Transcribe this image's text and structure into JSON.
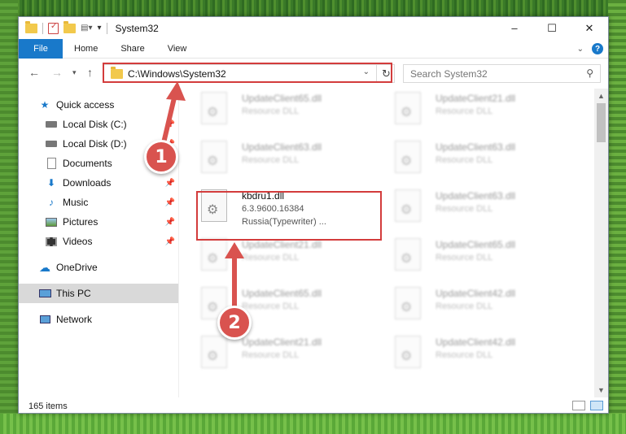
{
  "window": {
    "title": "System32",
    "controls": [
      "–",
      "☐",
      "✕"
    ]
  },
  "ribbon": {
    "tabs": [
      "File",
      "Home",
      "Share",
      "View"
    ]
  },
  "nav": {
    "address": "C:\\Windows\\System32",
    "search_placeholder": "Search System32"
  },
  "sidebar": {
    "items": [
      {
        "label": "Quick access",
        "icon": "star-icon"
      },
      {
        "label": "Local Disk (C:)",
        "icon": "drive-icon"
      },
      {
        "label": "Local Disk (D:)",
        "icon": "drive-icon"
      },
      {
        "label": "Documents",
        "icon": "documents-icon"
      },
      {
        "label": "Downloads",
        "icon": "download-icon"
      },
      {
        "label": "Music",
        "icon": "music-icon"
      },
      {
        "label": "Pictures",
        "icon": "pictures-icon"
      },
      {
        "label": "Videos",
        "icon": "videos-icon"
      },
      {
        "label": "OneDrive",
        "icon": "cloud-icon"
      },
      {
        "label": "This PC",
        "icon": "computer-icon"
      },
      {
        "label": "Network",
        "icon": "network-icon"
      }
    ]
  },
  "files": {
    "left": [
      {
        "name": "UpdateClient65.dll",
        "type": "Resource DLL"
      },
      {
        "name": "UpdateClient63.dll",
        "type": "Resource DLL"
      },
      {
        "name": "UpdateClient21.dll",
        "type": "Resource DLL"
      },
      {
        "name": "UpdateClient65.dll",
        "type": "Resource DLL"
      },
      {
        "name": "UpdateClient21.dll",
        "type": "Resource DLL"
      }
    ],
    "right": [
      {
        "name": "UpdateClient21.dll",
        "type": "Resource DLL"
      },
      {
        "name": "UpdateClient63.dll",
        "type": "Resource DLL"
      },
      {
        "name": "UpdateClient63.dll",
        "type": "Resource DLL"
      },
      {
        "name": "UpdateClient65.dll",
        "type": "Resource DLL"
      },
      {
        "name": "UpdateClient42.dll",
        "type": "Resource DLL"
      },
      {
        "name": "UpdateClient42.dll",
        "type": "Resource DLL"
      },
      {
        "name": "UpdateClient42.dll",
        "type": "Resource DLL"
      }
    ],
    "selected": {
      "name": "kbdru1.dll",
      "version": "6.3.9600.16384",
      "description": "Russia(Typewriter) ..."
    }
  },
  "status": {
    "item_count": "165 items"
  },
  "annotations": {
    "step1": "1",
    "step2": "2",
    "color": "#d9534f"
  }
}
